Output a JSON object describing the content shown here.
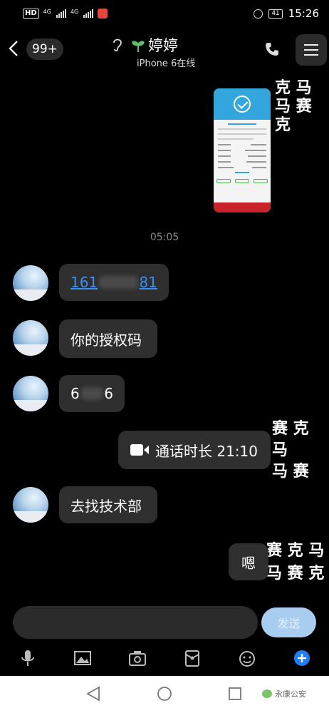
{
  "status_bar": {
    "hd_label": "HD",
    "network_labels": [
      "4G",
      "4G"
    ],
    "battery": "41",
    "time": "15:26"
  },
  "header": {
    "back_icon": "chevron-left-icon",
    "unread_badge": "99+",
    "contact_name": "婷婷",
    "contact_status": "iPhone 6在线",
    "icons": [
      "ear-icon",
      "sprout-icon",
      "phone-icon",
      "menu-icon"
    ]
  },
  "chat": {
    "timestamp": "05:05",
    "messages": [
      {
        "side": "right",
        "type": "image",
        "description": "screenshot-thumbnail"
      },
      {
        "side": "left",
        "type": "link",
        "text_start": "161",
        "text_end": "81"
      },
      {
        "side": "left",
        "type": "text",
        "text": "你的授权码"
      },
      {
        "side": "left",
        "type": "text",
        "text_start": "6",
        "text_end": "6"
      },
      {
        "side": "right",
        "type": "call",
        "text": "通话时长 21:10"
      },
      {
        "side": "left",
        "type": "text",
        "text": "去找技术部"
      },
      {
        "side": "right",
        "type": "text",
        "text": "嗯"
      }
    ],
    "decorations": [
      {
        "row1": "克 马",
        "row2": "马 赛 克"
      },
      {
        "row1": "赛 克 马",
        "row2": "马 赛"
      },
      {
        "row1": "赛 克 马",
        "row2": "马 赛 克"
      }
    ]
  },
  "composer": {
    "input_value": "",
    "send_label": "发送"
  },
  "toolbar": {
    "icons": [
      "microphone-icon",
      "image-icon",
      "camera-icon",
      "red-packet-icon",
      "emoji-icon",
      "plus-icon"
    ]
  },
  "nav_bar": {
    "watermark": "永康公安"
  }
}
